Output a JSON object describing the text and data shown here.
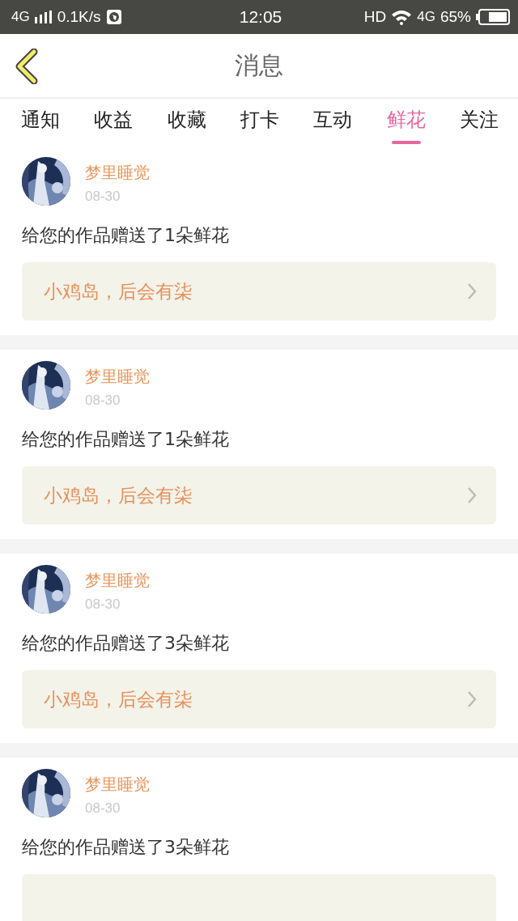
{
  "status_bar": {
    "network": "4G",
    "speed": "0.1K/s",
    "time": "12:05",
    "hd": "HD",
    "data": "4G",
    "battery": "65%"
  },
  "header": {
    "title": "消息"
  },
  "tabs": [
    {
      "label": "通知",
      "selected": false
    },
    {
      "label": "收益",
      "selected": false
    },
    {
      "label": "收藏",
      "selected": false
    },
    {
      "label": "打卡",
      "selected": false
    },
    {
      "label": "互动",
      "selected": false
    },
    {
      "label": "鲜花",
      "selected": true
    },
    {
      "label": "关注",
      "selected": false
    }
  ],
  "messages": [
    {
      "name": "梦里睡觉",
      "date": "08-30",
      "text": "给您的作品赠送了1朵鲜花",
      "work": "小鸡岛，后会有柒"
    },
    {
      "name": "梦里睡觉",
      "date": "08-30",
      "text": "给您的作品赠送了1朵鲜花",
      "work": "小鸡岛，后会有柒"
    },
    {
      "name": "梦里睡觉",
      "date": "08-30",
      "text": "给您的作品赠送了3朵鲜花",
      "work": "小鸡岛，后会有柒"
    },
    {
      "name": "梦里睡觉",
      "date": "08-30",
      "text": "给您的作品赠送了3朵鲜花"
    }
  ]
}
